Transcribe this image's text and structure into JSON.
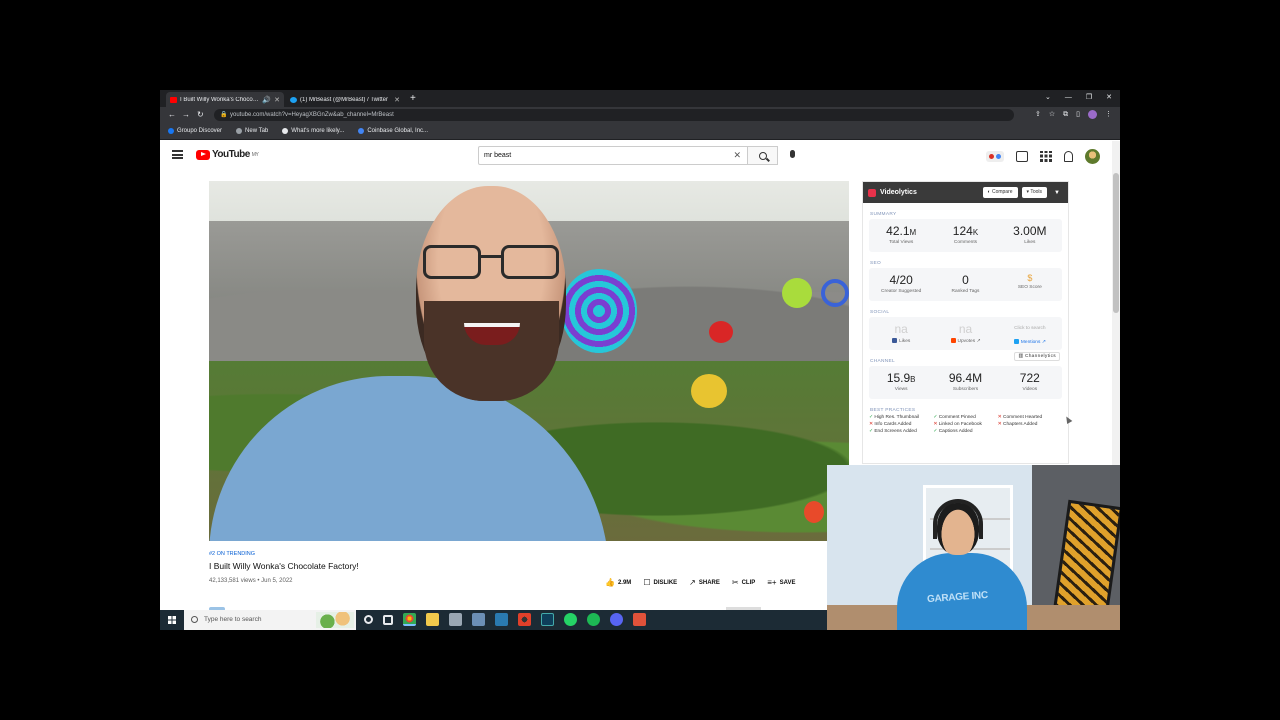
{
  "browser": {
    "tabs": [
      {
        "title": "I Built Willy Wonka's Chocolate Factory",
        "active": true,
        "favicon_color": "#ff0000"
      },
      {
        "title": "(1) MrBeast (@MrBeast) / Twitter",
        "active": false,
        "favicon_color": "#1da1f2"
      }
    ],
    "new_tab_symbol": "+",
    "url": "youtube.com/watch?v=HeyagXBGnZw&ab_channel=MrBeast",
    "bookmarks": [
      {
        "label": "Groupo Discover",
        "color": "#1877f2"
      },
      {
        "label": "New Tab",
        "color": "#9aa0a6"
      },
      {
        "label": "What's more likely...",
        "color": "#e8eaed"
      },
      {
        "label": "Coinbase Global, Inc...",
        "color": "#4285f4"
      }
    ],
    "window_controls": [
      "⌄",
      "—",
      "❐",
      "✕"
    ]
  },
  "youtube": {
    "logo_text": "YouTube",
    "logo_region": "MY",
    "search_query": "mr beast",
    "clear_symbol": "✕"
  },
  "video": {
    "trending_label": "#2 ON TRENDING",
    "title": "I Built Willy Wonka's Chocolate Factory!",
    "meta": "42,133,581 views • Jun 5, 2022",
    "actions": [
      {
        "icon": "thumbs-up",
        "glyph": "👍",
        "label": "2.9M"
      },
      {
        "icon": "thumbs-down",
        "glyph": "☐",
        "label": "DISLIKE"
      },
      {
        "icon": "share",
        "glyph": "↗",
        "label": "SHARE"
      },
      {
        "icon": "scissors",
        "glyph": "✂",
        "label": "CLIP"
      },
      {
        "icon": "playlist-add",
        "glyph": "≡+",
        "label": "SAVE"
      }
    ]
  },
  "videolytics": {
    "name": "Videolytics",
    "compare_label": "Compare",
    "tools_label": "Tools",
    "summary": {
      "heading": "SUMMARY",
      "stats": [
        {
          "value": "42.1",
          "unit": "M",
          "label": "Total Views"
        },
        {
          "value": "124",
          "unit": "K",
          "label": "Comments"
        },
        {
          "value": "3.00M",
          "unit": "",
          "label": "Likes"
        }
      ]
    },
    "seo": {
      "heading": "SEO",
      "stats": [
        {
          "value": "4/20",
          "label": "Creator Suggested"
        },
        {
          "value": "0",
          "label": "Ranked Tags"
        },
        {
          "value": "",
          "label": "SEO Score"
        }
      ]
    },
    "social": {
      "heading": "SOCIAL",
      "stats": [
        {
          "value": "na",
          "label": "Likes",
          "color": "#3b5998"
        },
        {
          "value": "na",
          "label": "Upvotes ↗",
          "color": "#ff4500"
        },
        {
          "value": "Click to search",
          "label": "Mentions ↗",
          "color": "#1da1f2"
        }
      ]
    },
    "channel": {
      "heading": "CHANNEL",
      "button": "Channelytics",
      "stats": [
        {
          "value": "15.9",
          "unit": "B",
          "label": "Views"
        },
        {
          "value": "96.4M",
          "unit": "",
          "label": "Subscribers"
        },
        {
          "value": "722",
          "unit": "",
          "label": "Videos"
        }
      ]
    },
    "best_practices": {
      "heading": "BEST PRACTICES",
      "items": [
        {
          "text": "High Res. Thumbnail",
          "ok": true
        },
        {
          "text": "Comment Pinned",
          "ok": true
        },
        {
          "text": "Comment Hearted",
          "ok": false
        },
        {
          "text": "Info Cards Added",
          "ok": false
        },
        {
          "text": "Linked on Facebook",
          "ok": false
        },
        {
          "text": "Chapters Added",
          "ok": false
        },
        {
          "text": "End Screens Added",
          "ok": true
        },
        {
          "text": "Captions Added",
          "ok": true
        }
      ]
    }
  },
  "taskbar": {
    "search_placeholder": "Type here to search"
  },
  "webcam": {
    "shirt_text": "GARAGE INC"
  }
}
